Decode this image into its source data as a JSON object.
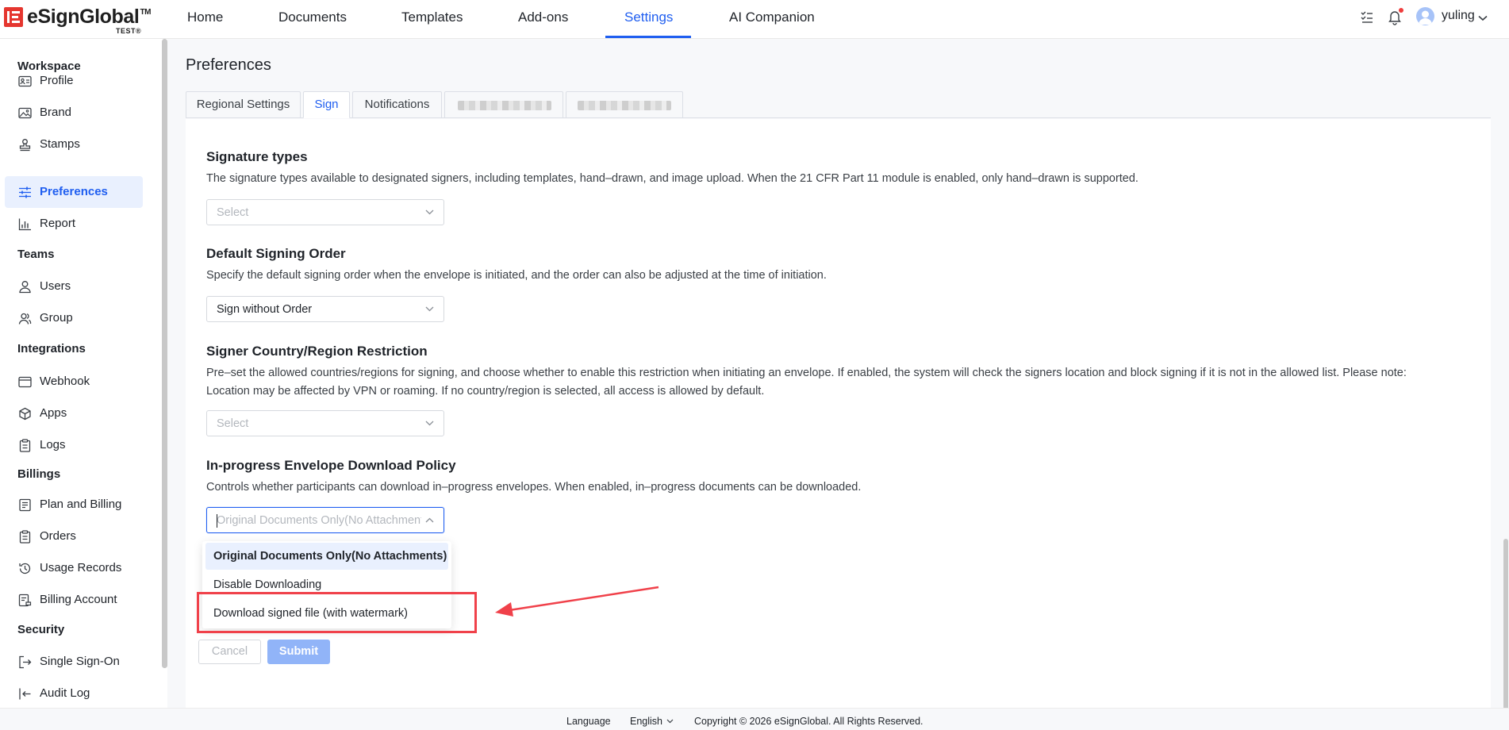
{
  "brand": {
    "name": "eSignGlobal",
    "trademark": "TM",
    "env_badge": "TEST®"
  },
  "nav": {
    "items": [
      {
        "label": "Home"
      },
      {
        "label": "Documents"
      },
      {
        "label": "Templates"
      },
      {
        "label": "Add-ons"
      },
      {
        "label": "Settings",
        "active": true
      },
      {
        "label": "AI Companion"
      }
    ]
  },
  "user": {
    "name": "yuling"
  },
  "sidebar": {
    "sections": [
      {
        "title": "Workspace",
        "items": [
          {
            "label": "Profile",
            "icon": "profile-card-icon"
          },
          {
            "label": "Brand",
            "icon": "image-icon"
          },
          {
            "label": "Stamps",
            "icon": "stamp-icon"
          },
          {
            "label": "Preferences",
            "icon": "sliders-icon",
            "active": true
          },
          {
            "label": "Report",
            "icon": "bar-chart-icon"
          }
        ]
      },
      {
        "title": "Teams",
        "items": [
          {
            "label": "Users",
            "icon": "user-icon"
          },
          {
            "label": "Group",
            "icon": "group-icon"
          }
        ]
      },
      {
        "title": "Integrations",
        "items": [
          {
            "label": "Webhook",
            "icon": "webhook-icon"
          },
          {
            "label": "Apps",
            "icon": "cube-icon"
          },
          {
            "label": "Logs",
            "icon": "clipboard-icon"
          }
        ]
      },
      {
        "title": "Billings",
        "items": [
          {
            "label": "Plan and Billing",
            "icon": "document-icon"
          },
          {
            "label": "Orders",
            "icon": "clipboard-icon"
          },
          {
            "label": "Usage Records",
            "icon": "history-icon"
          },
          {
            "label": "Billing Account",
            "icon": "account-icon"
          }
        ]
      },
      {
        "title": "Security",
        "items": [
          {
            "label": "Single Sign-On",
            "icon": "sso-icon"
          },
          {
            "label": "Audit Log",
            "icon": "audit-icon"
          }
        ]
      }
    ]
  },
  "page": {
    "title": "Preferences",
    "tabs": [
      {
        "label": "Regional Settings"
      },
      {
        "label": "Sign",
        "active": true
      },
      {
        "label": "Notifications"
      }
    ]
  },
  "settings": {
    "signature_types": {
      "title": "Signature types",
      "description": "The signature types available to designated signers, including templates, hand–drawn, and image upload. When the 21 CFR Part 11 module is enabled, only hand–drawn is supported.",
      "placeholder": "Select"
    },
    "signing_order": {
      "title": "Default Signing Order",
      "description": "Specify the default signing order when the envelope is initiated, and the order can also be adjusted at the time of initiation.",
      "value": "Sign without Order"
    },
    "region_restriction": {
      "title": "Signer Country/Region Restriction",
      "description_line1": "Pre–set the allowed countries/regions for signing, and choose whether to enable this restriction when initiating an envelope. If enabled, the system will check the signers location and block signing if it is not in the allowed list. Please note:",
      "description_line2": "Location may be affected by VPN or roaming. If no country/region is selected, all access is allowed by default.",
      "placeholder": "Select"
    },
    "download_policy": {
      "title": "In-progress Envelope Download Policy",
      "description": "Controls whether participants can download in–progress envelopes. When enabled, in–progress documents can be downloaded.",
      "placeholder": "Original Documents Only(No Attachments)",
      "options": [
        {
          "label": "Original Documents Only(No Attachments)",
          "selected": true
        },
        {
          "label": "Disable Downloading"
        },
        {
          "label": "Download signed file (with watermark)"
        }
      ]
    }
  },
  "actions": {
    "cancel": "Cancel",
    "submit": "Submit"
  },
  "footer": {
    "language_label": "Language",
    "language_value": "English",
    "copyright": "Copyright © 2026 eSignGlobal. All Rights Reserved."
  },
  "colors": {
    "accent": "#1f5ef0",
    "brand_red": "#e5362f",
    "annotation_red": "#f0414a"
  }
}
